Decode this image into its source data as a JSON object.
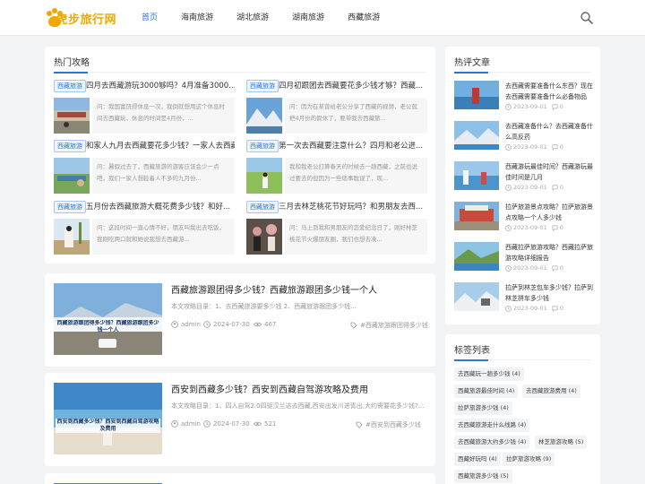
{
  "site": {
    "logo_text": "虎步旅行网"
  },
  "nav": {
    "items": [
      "首页",
      "海南旅游",
      "湖北旅游",
      "湖南旅游",
      "西藏旅游"
    ]
  },
  "hot": {
    "title": "热门攻略",
    "items": [
      {
        "tag": "西藏旅游",
        "title": "四月去西藏游玩3000够吗？4月准备3000...",
        "desc": "问：我国富饶得休息一次，我倒就想用这个休息时间去西藏玩，休息的时间是4月份，..."
      },
      {
        "tag": "西藏旅游",
        "title": "四月初跟团去西藏要花多少钱才够？西藏...",
        "desc": "问：因为在某曾给老公分享了西藏的视频，老公就把4月份的假休了，要带我去西藏旅..."
      },
      {
        "tag": "西藏旅游",
        "title": "和家人九月去西藏要花多少钱？一家人去西藏...",
        "desc": "问：暑假过去了，西藏旅游的游客应该会少一点吧，我们一家人想趁着人不多的九月份..."
      },
      {
        "tag": "西藏旅游",
        "title": "第一次去西藏要注意什么？四月和老公进...",
        "desc": "我和我老公打算春天的时候去一趟西藏，之前也说过要去的但因为一些琐事耽误了，现..."
      },
      {
        "tag": "西藏旅游",
        "title": "五月份去西藏旅游大概花费多少钱？和好...",
        "desc": "问：这段时间一直心情不好，朋友叫我出去吃饭，我刚吃两口就和她说我想去西藏游..."
      },
      {
        "tag": "西藏旅游",
        "title": "三月去林芝桃花节好玩吗？和男朋友去西...",
        "desc": "问：马上到我和男朋友的恋爱纪念日了，刚好林芝桃花节火爆朋友圈，我们也想去凑..."
      }
    ]
  },
  "articles": [
    {
      "title": "西藏旅游跟团得多少钱？西藏旅游跟团多少钱一个人",
      "excerpt": "本文攻略目录：1、去西藏旅游要多少钱 2、西藏旅游跟团多少钱...",
      "author": "admin",
      "date": "2024-07-30",
      "views": "467",
      "tag": "#西藏旅游跟团得多少钱",
      "thumb_caption": "西藏旅游跟团得多少钱？西藏旅游跟团多少钱一个人"
    },
    {
      "title": "西安到西藏多少钱？西安到西藏自驾游攻略及费用",
      "excerpt": "本文攻略目录：1、四人自驾2.0四驱汉兰达去西藏,西安出发川进青出,大约需要花多少钱?...",
      "author": "admin",
      "date": "2024-07-30",
      "views": "521",
      "tag": "#西安到西藏多少钱",
      "thumb_caption": "西安到西藏多少钱？西安到西藏自驾游攻略及费用"
    }
  ],
  "sidebar": {
    "hot_title": "热评文章",
    "hot_items": [
      {
        "title": "去西藏需要准备什么东西？现在去西藏需要准备什么必备物品",
        "date": "2023-09-01",
        "comments": "0"
      },
      {
        "title": "去西藏准备什么？去西藏准备什么高反药",
        "date": "2023-09-01",
        "comments": "0"
      },
      {
        "title": "西藏游玩最佳时间？西藏游玩最佳时间是几月",
        "date": "2023-09-01",
        "comments": "0"
      },
      {
        "title": "拉萨旅游景点攻略？拉萨旅游景点攻略一个人多少钱",
        "date": "2023-09-01",
        "comments": "0"
      },
      {
        "title": "西藏拉萨旅游攻略？西藏拉萨旅游攻略详细报告",
        "date": "2023-09-01",
        "comments": "0"
      },
      {
        "title": "拉萨到林芝包车多少钱？拉萨到林芝拼车多少钱",
        "date": "2023-09-01",
        "comments": "0"
      }
    ],
    "tags_title": "标签列表",
    "tags": [
      "去西藏玩一趟多少钱 (4)",
      "西藏旅游最佳时间 (4)",
      "去西藏旅游费用 (4)",
      "拉萨旅游多少钱 (4)",
      "去西藏旅游走什么线路 (4)",
      "去西藏旅游大约多少钱 (4)",
      "林芝旅游攻略 (5)",
      "西藏好玩吗 (4)",
      "拉萨旅游攻略 (9)",
      "西藏旅游多少钱 (5)"
    ]
  },
  "colors": {
    "accent": "#2a79d8",
    "logo": "#f0a800",
    "background": "#f2f3f5"
  }
}
